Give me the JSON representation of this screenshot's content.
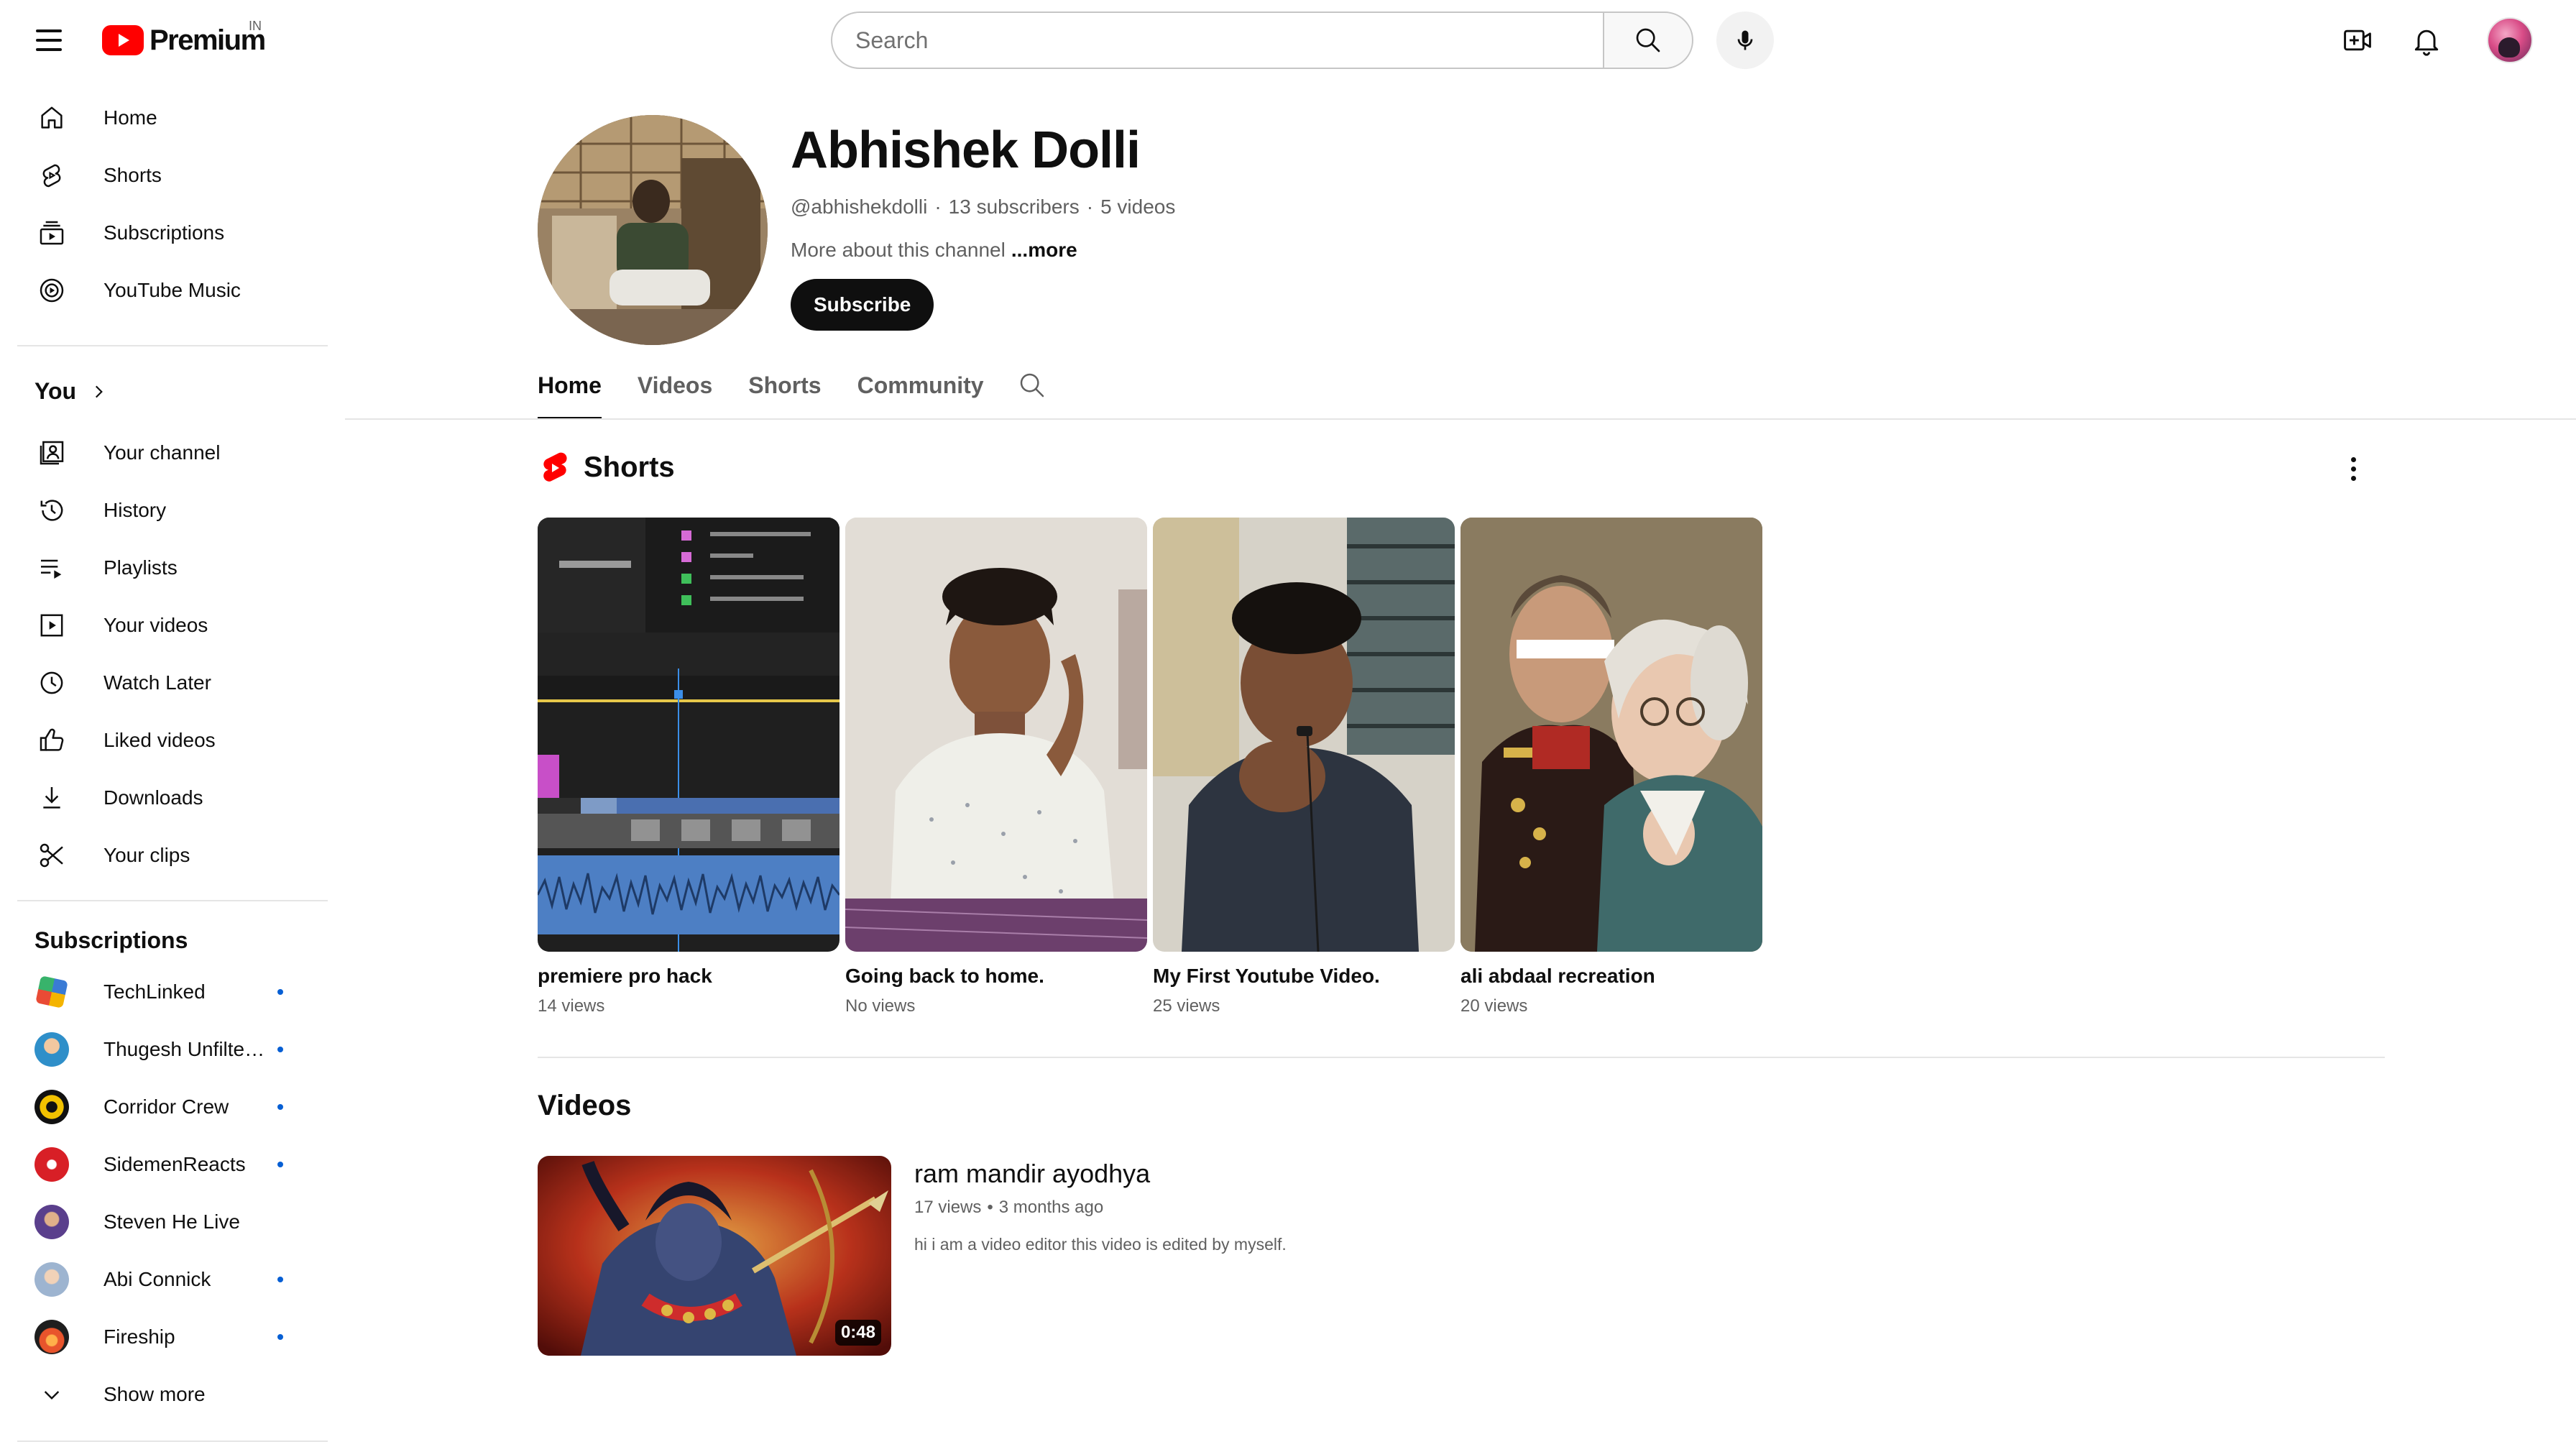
{
  "brand": {
    "logo_text": "Premium",
    "country_code": "IN"
  },
  "search": {
    "placeholder": "Search"
  },
  "sidebar": {
    "primary": [
      {
        "label": "Home",
        "icon": "home-icon"
      },
      {
        "label": "Shorts",
        "icon": "shorts-icon"
      },
      {
        "label": "Subscriptions",
        "icon": "subscriptions-icon"
      },
      {
        "label": "YouTube Music",
        "icon": "music-icon"
      }
    ],
    "you_heading": "You",
    "you_items": [
      {
        "label": "Your channel",
        "icon": "your-channel-icon"
      },
      {
        "label": "History",
        "icon": "history-icon"
      },
      {
        "label": "Playlists",
        "icon": "playlists-icon"
      },
      {
        "label": "Your videos",
        "icon": "your-videos-icon"
      },
      {
        "label": "Watch Later",
        "icon": "clock-icon"
      },
      {
        "label": "Liked videos",
        "icon": "thumbs-up-icon"
      },
      {
        "label": "Downloads",
        "icon": "download-icon"
      },
      {
        "label": "Your clips",
        "icon": "scissors-icon"
      }
    ],
    "subscriptions_heading": "Subscriptions",
    "subscriptions": [
      {
        "label": "TechLinked",
        "new": true,
        "color": "#3a7bd5"
      },
      {
        "label": "Thugesh Unfiltered",
        "new": true,
        "color": "#2f8fc9"
      },
      {
        "label": "Corridor Crew",
        "new": true,
        "color": "#f2c200"
      },
      {
        "label": "SidemenReacts",
        "new": true,
        "color": "#d81f26"
      },
      {
        "label": "Steven He Live",
        "new": false,
        "color": "#5a3f8c"
      },
      {
        "label": "Abi Connick",
        "new": true,
        "color": "#9db4d0"
      },
      {
        "label": "Fireship",
        "new": true,
        "color": "#e8542c"
      }
    ],
    "show_more": "Show more"
  },
  "channel": {
    "name": "Abhishek Dolli",
    "handle": "@abhishekdolli",
    "subscribers": "13 subscribers",
    "video_count": "5 videos",
    "about": "More about this channel",
    "about_more": "...more",
    "subscribe_label": "Subscribe"
  },
  "tabs": [
    {
      "label": "Home",
      "active": true
    },
    {
      "label": "Videos",
      "active": false
    },
    {
      "label": "Shorts",
      "active": false
    },
    {
      "label": "Community",
      "active": false
    }
  ],
  "shorts_section": {
    "title": "Shorts",
    "items": [
      {
        "title": "premiere pro hack",
        "views": "14 views"
      },
      {
        "title": "Going back to home.",
        "views": "No views"
      },
      {
        "title": "My First Youtube Video.",
        "views": "25 views"
      },
      {
        "title": "ali abdaal recreation",
        "views": "20 views"
      }
    ]
  },
  "videos_section": {
    "title": "Videos",
    "items": [
      {
        "title": "ram mandir ayodhya",
        "views": "17 views",
        "age": "3 months ago",
        "description": "hi i am a video editor this video is edited by myself.",
        "duration": "0:48"
      }
    ]
  },
  "colors": {
    "brand_red": "#ff0000",
    "link_blue": "#065fd4",
    "text_primary": "#0f0f0f",
    "text_secondary": "#606060"
  }
}
